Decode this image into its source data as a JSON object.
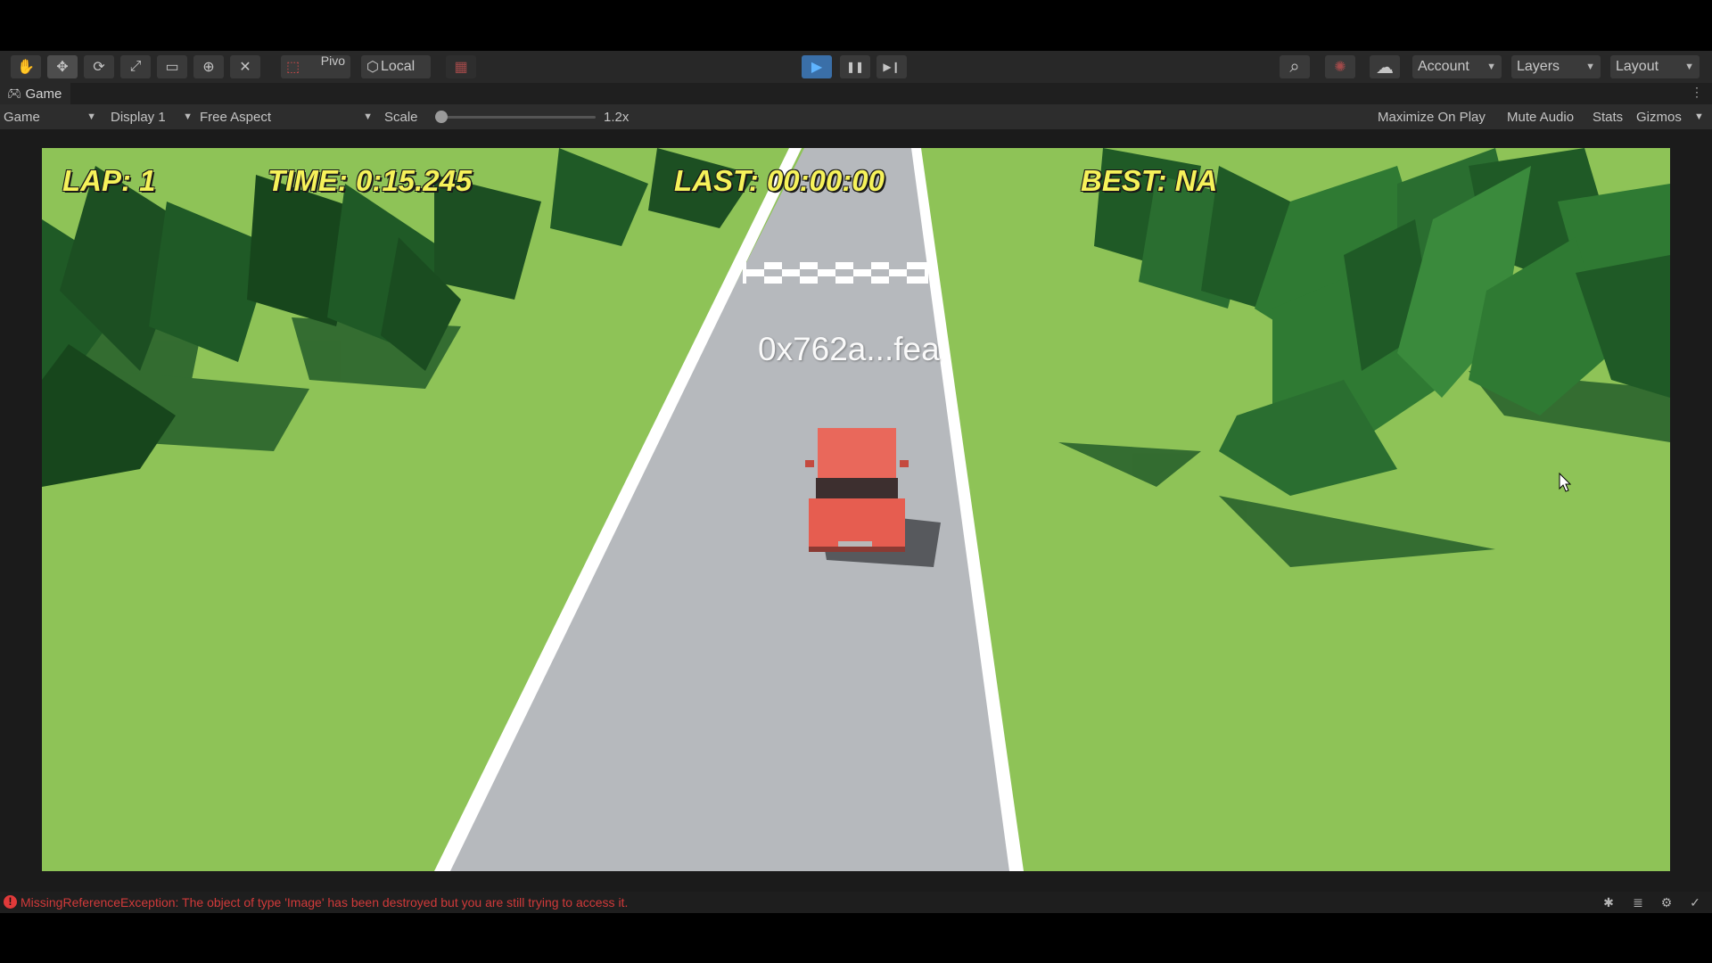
{
  "toolbar": {
    "tools": [
      {
        "name": "hand-tool",
        "glyph": "✋"
      },
      {
        "name": "move-tool",
        "glyph": "✥"
      },
      {
        "name": "rotate-tool",
        "glyph": "⟳"
      },
      {
        "name": "scale-tool",
        "glyph": "⤢"
      },
      {
        "name": "rect-tool",
        "glyph": "▭"
      },
      {
        "name": "transform-tool",
        "glyph": "⊕"
      },
      {
        "name": "custom-tool",
        "glyph": "✕"
      }
    ],
    "pivot_label": "Pivo",
    "local_label": "Local",
    "grid_glyph": "▦",
    "play_glyph": "▶",
    "pause_glyph": "❚❚",
    "step_glyph": "▶❙",
    "search_glyph": "⌕",
    "collab_glyph": "✺",
    "cloud_glyph": "☁",
    "account_label": "Account",
    "layers_label": "Layers",
    "layout_label": "Layout"
  },
  "tab": {
    "title": "Game"
  },
  "gamebar": {
    "view_select": "Game",
    "display_select": "Display 1",
    "aspect_select": "Free Aspect",
    "scale_label": "Scale",
    "scale_value": "1.2x",
    "scale_fraction": 0.04,
    "maximize_label": "Maximize On Play",
    "mute_label": "Mute Audio",
    "stats_label": "Stats",
    "gizmos_label": "Gizmos"
  },
  "hud": {
    "lap": "LAP: 1",
    "time": "TIME: 0:15.245",
    "last": "LAST: 00:00:00",
    "best": "BEST: NA",
    "wallet": "0x762a...fea"
  },
  "colors": {
    "hud_text": "#f6f25a",
    "grass": "#8ec357",
    "road": "#b6b9bd",
    "car": "#e9685b",
    "tree_dark": "#1f5a26",
    "tree_light": "#2f7a33",
    "error": "#d13a3a",
    "play_active": "#3a8fe0"
  },
  "status": {
    "error_message": "MissingReferenceException: The object of type 'Image' has been destroyed but you are still trying to access it."
  }
}
